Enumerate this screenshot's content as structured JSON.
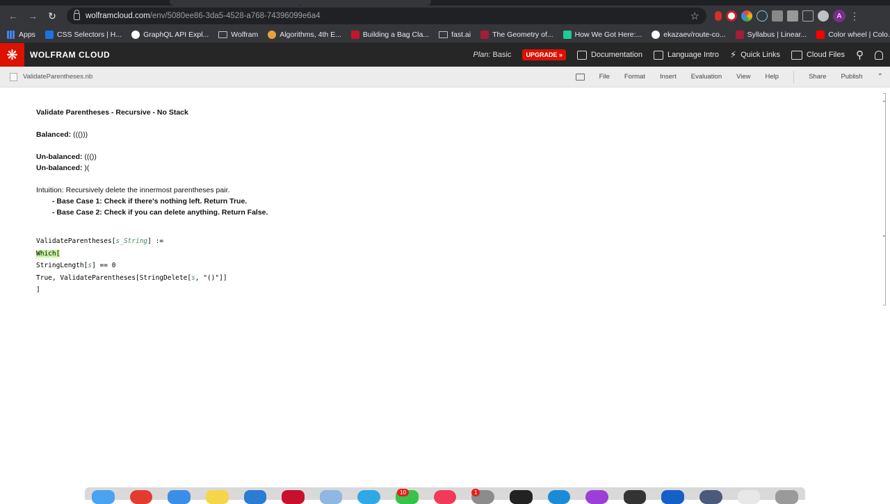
{
  "browser": {
    "url_host": "wolframcloud.com",
    "url_path": "/env/5080ee86-3da5-4528-a768-74396099e6a4",
    "avatar_letter": "A",
    "bookmarks": [
      {
        "label": "Apps",
        "color": "#4285f4"
      },
      {
        "label": "CSS Selectors | H...",
        "color": "#1a73e8"
      },
      {
        "label": "GraphQL API Expl...",
        "color": "#ffffff"
      },
      {
        "label": "Wolfram",
        "color": "folder"
      },
      {
        "label": "Algorithms, 4th E...",
        "color": "#e8a13a"
      },
      {
        "label": "Building a Bag Cla...",
        "color": "#c4162a"
      },
      {
        "label": "fast.ai",
        "color": "folder"
      },
      {
        "label": "The Geometry of...",
        "color": "#a31f34"
      },
      {
        "label": "How We Got Here:...",
        "color": "#20c997"
      },
      {
        "label": "ekazaev/route-co...",
        "color": "#ffffff"
      },
      {
        "label": "Syllabus | Linear...",
        "color": "#a31f34"
      },
      {
        "label": "Color wheel | Colo...",
        "color": "#ff0000"
      }
    ],
    "bookmarks_more": "»"
  },
  "wolfram": {
    "brand": "WOLFRAM CLOUD",
    "plan_label": "Plan:",
    "plan_value": "Basic",
    "upgrade": "UPGRADE »",
    "links": [
      "Documentation",
      "Language Intro",
      "Quick Links",
      "Cloud Files"
    ]
  },
  "notebook": {
    "filename": "ValidateParentheses.nb",
    "menu": [
      "File",
      "Format",
      "Insert",
      "Evaluation",
      "View",
      "Help",
      "Share",
      "Publish"
    ]
  },
  "content": {
    "title": "Validate Parentheses - Recursive - No Stack",
    "balanced_label": "Balanced:",
    "balanced_value": " ((()))",
    "unbalanced_label": "Un-balanced:",
    "unbalanced_value_1": " ((())",
    "unbalanced_value_2": " )(",
    "intuition": "Intuition: Recursively delete the innermost parentheses pair.",
    "base_case_1": "- Base Case 1: Check if there's nothing left. Return True.",
    "base_case_2": "- Base Case 2: Check if you can delete anything. Return False.",
    "code": {
      "line1_fn": "ValidateParentheses[",
      "line1_var": "s_String",
      "line1_end": "] :=",
      "line2": "Which[",
      "line3_a": " StringLength[",
      "line3_var": "s",
      "line3_b": "] == 0",
      "line4_a": " True, ValidateParentheses[StringDelete[",
      "line4_var": "s",
      "line4_b": ", \"()\"]]",
      "line5": "]"
    }
  },
  "dock": {
    "badges": [
      "10",
      "1"
    ]
  }
}
